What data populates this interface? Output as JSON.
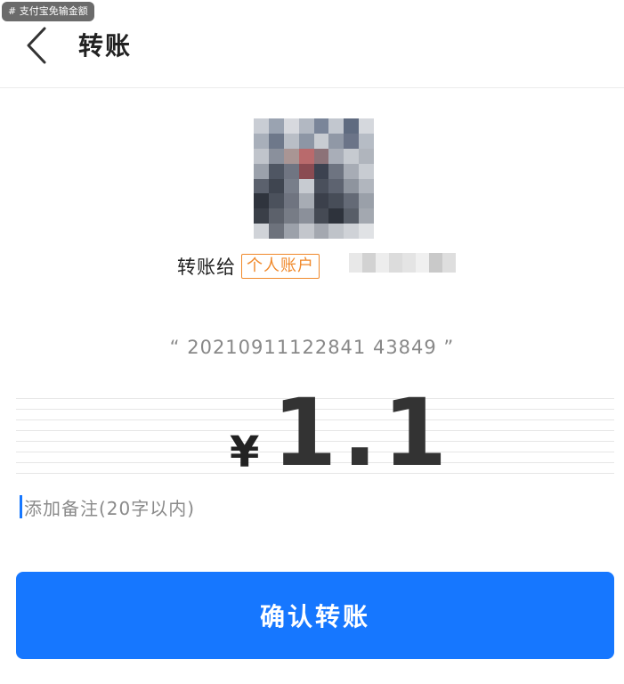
{
  "tag": "# 支付宝免输金额",
  "header": {
    "title": "转账"
  },
  "recipient": {
    "label": "转账给",
    "badge": "个人账户"
  },
  "order_note": "“ 20210911122841 43849 ”",
  "amount": {
    "currency": "¥",
    "value": "1.1"
  },
  "note": {
    "placeholder": "添加备注(20字以内)"
  },
  "confirm_button": {
    "label": "确认转账"
  },
  "colors": {
    "primary": "#1677ff",
    "badge": "#f0892b"
  }
}
